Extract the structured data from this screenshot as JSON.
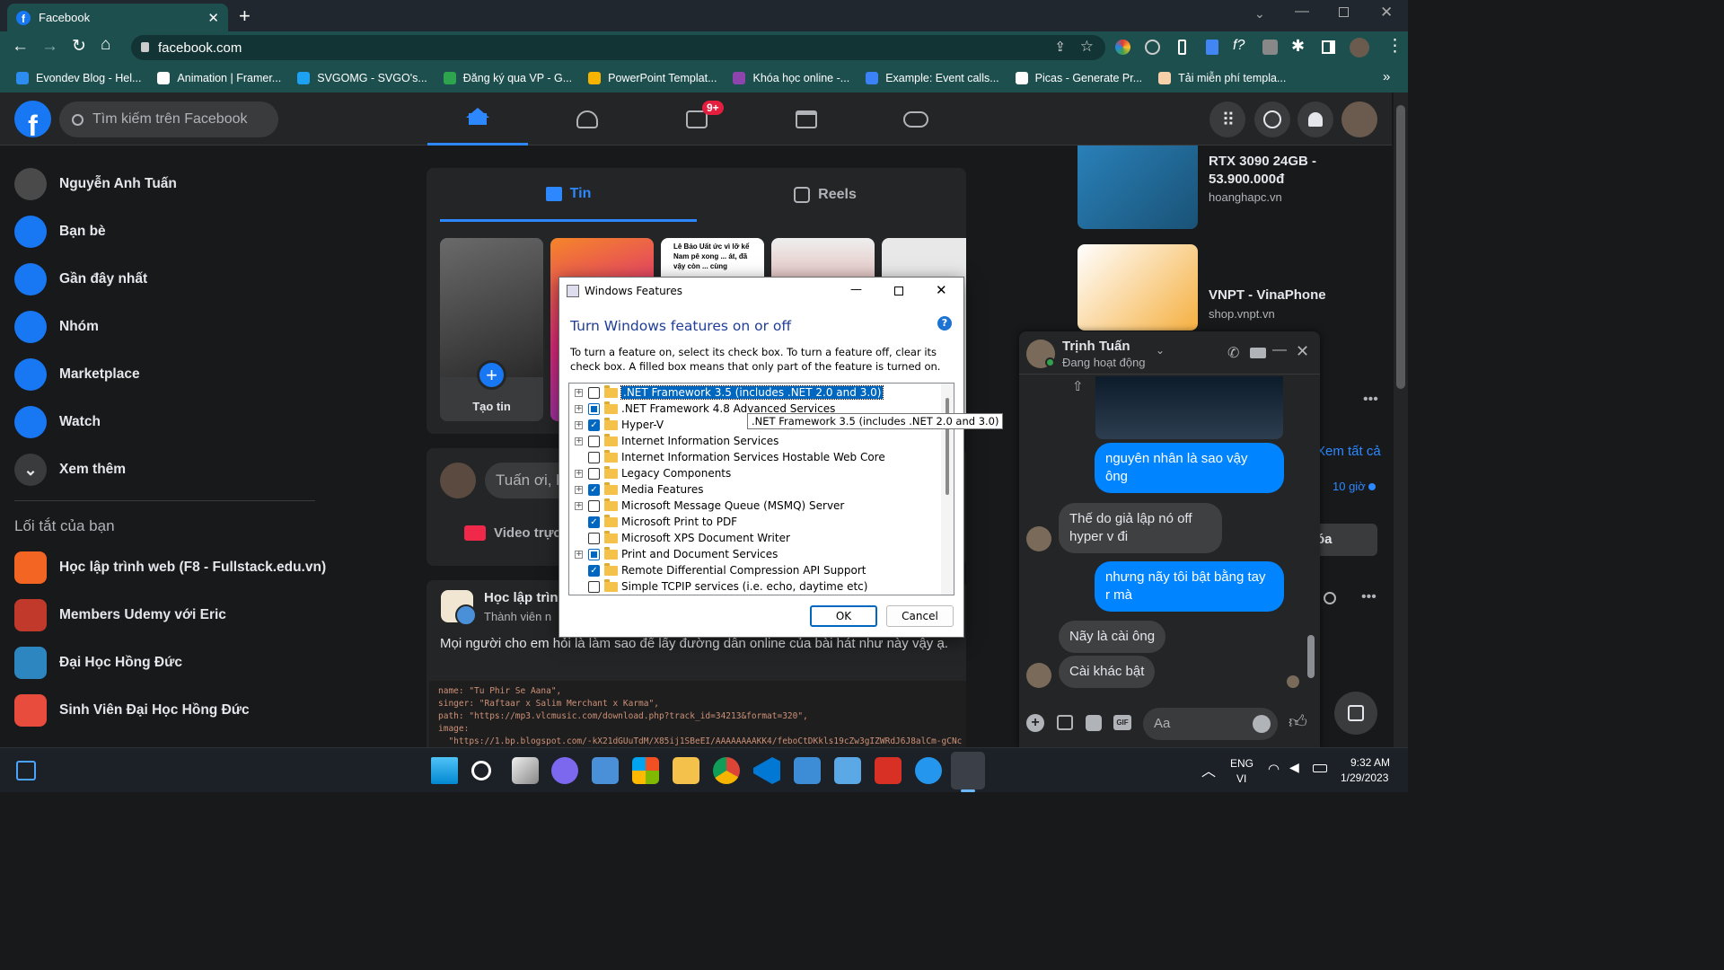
{
  "browser": {
    "tab_title": "Facebook",
    "url": "facebook.com",
    "bookmarks": [
      {
        "label": "Evondev Blog - Hel...",
        "color": "#2d8cf0"
      },
      {
        "label": "Animation | Framer...",
        "color": "#ffffff"
      },
      {
        "label": "SVGOMG - SVGO's...",
        "color": "#1da1f2"
      },
      {
        "label": "Đăng ký qua VP - G...",
        "color": "#2ea44f"
      },
      {
        "label": "PowerPoint Templat...",
        "color": "#f4b400"
      },
      {
        "label": "Khóa học online -...",
        "color": "#8e44ad"
      },
      {
        "label": "Example: Event calls...",
        "color": "#3b82f6"
      },
      {
        "label": "Picas - Generate Pr...",
        "color": "#ffffff"
      },
      {
        "label": "Tải miễn phí templa...",
        "color": "#f5d0a9"
      }
    ]
  },
  "fb": {
    "search_placeholder": "Tìm kiếm trên Facebook",
    "notification_badge": "9+",
    "sidebar": [
      {
        "label": "Nguyễn Anh Tuấn",
        "icon": "avatar",
        "color": "#4a4a4a"
      },
      {
        "label": "Bạn bè",
        "icon": "friends-icon",
        "color": "#1877f2"
      },
      {
        "label": "Gần đây nhất",
        "icon": "clock-icon",
        "color": "#1877f2"
      },
      {
        "label": "Nhóm",
        "icon": "groups-icon",
        "color": "#1877f2"
      },
      {
        "label": "Marketplace",
        "icon": "marketplace-icon",
        "color": "#1877f2"
      },
      {
        "label": "Watch",
        "icon": "watch-icon",
        "color": "#1877f2"
      },
      {
        "label": "Xem thêm",
        "icon": "chevron-down-icon",
        "color": "#3a3b3c"
      }
    ],
    "shortcuts_title": "Lối tắt của bạn",
    "shortcuts": [
      {
        "label": "Học lập trình web (F8 - Fullstack.edu.vn)",
        "color": "#f26522"
      },
      {
        "label": "Members Udemy với Eric",
        "color": "#c0392b"
      },
      {
        "label": "Đại Học Hồng Đức",
        "color": "#2e86c1"
      },
      {
        "label": "Sinh Viên Đại Học Hồng Đức",
        "color": "#e74c3c"
      }
    ],
    "feed": {
      "tab_stories": "Tin",
      "tab_reels": "Reels",
      "create_story": "Tạo tin",
      "story_thumb_text": "Lê Bảo Uất ức vì lỡ kể Nam pê xong ... át, đã vậy còn ... cùng",
      "composer_placeholder": "Tuấn ơi, b",
      "live_video": "Video trực",
      "post_group": "Học lập trìn",
      "post_member": "Thành viên n",
      "post_text": "Mọi người cho em hỏi là làm sao để lấy đường dẫn online của bài hát như này vậy ạ.",
      "code_lines": [
        "name: \"Tu Phir Se Aana\",",
        "singer: \"Raftaar x Salim Merchant x Karma\",",
        "path: \"https://mp3.vlcmusic.com/download.php?track_id=34213&format=320\",",
        "image:",
        "  \"https://1.bp.blogspot.com/-kX21dGUuTdM/X85ij1SBeEI/AAAAAAAAKK4/feboCtDKkls19cZw3gIZWRdJ6J8alCm-gCNc"
      ]
    },
    "ads": [
      {
        "title": "RTX 3090 24GB - 53.900.000đ",
        "domain": "hoanghapc.vn"
      },
      {
        "title": "VNPT - VinaPhone",
        "domain": "shop.vnpt.vn"
      }
    ],
    "right_partial": {
      "see_all": "Xem tất cả",
      "time": "10 giờ",
      "button": "óa"
    }
  },
  "dialog": {
    "title": "Windows Features",
    "heading": "Turn Windows features on or off",
    "description": "To turn a feature on, select its check box. To turn a feature off, clear its check box. A filled box means that only part of the feature is turned on.",
    "tooltip": ".NET Framework 3.5 (includes .NET 2.0 and 3.0)",
    "features": [
      {
        "label": ".NET Framework 3.5 (includes .NET 2.0 and 3.0)",
        "expand": true,
        "state": "unchecked",
        "selected": true
      },
      {
        "label": ".NET Framework 4.8 Advanced Services",
        "expand": true,
        "state": "partial",
        "selected": false
      },
      {
        "label": "Hyper-V",
        "expand": true,
        "state": "checked",
        "selected": false
      },
      {
        "label": "Internet Information Services",
        "expand": true,
        "state": "unchecked",
        "selected": false
      },
      {
        "label": "Internet Information Services Hostable Web Core",
        "expand": false,
        "state": "unchecked",
        "selected": false
      },
      {
        "label": "Legacy Components",
        "expand": true,
        "state": "unchecked",
        "selected": false
      },
      {
        "label": "Media Features",
        "expand": true,
        "state": "checked",
        "selected": false
      },
      {
        "label": "Microsoft Message Queue (MSMQ) Server",
        "expand": true,
        "state": "unchecked",
        "selected": false
      },
      {
        "label": "Microsoft Print to PDF",
        "expand": false,
        "state": "checked",
        "selected": false
      },
      {
        "label": "Microsoft XPS Document Writer",
        "expand": false,
        "state": "unchecked",
        "selected": false
      },
      {
        "label": "Print and Document Services",
        "expand": true,
        "state": "partial",
        "selected": false
      },
      {
        "label": "Remote Differential Compression API Support",
        "expand": false,
        "state": "checked",
        "selected": false
      },
      {
        "label": "Simple TCPIP services (i.e. echo, daytime etc)",
        "expand": false,
        "state": "unchecked",
        "selected": false
      }
    ],
    "ok": "OK",
    "cancel": "Cancel"
  },
  "chat": {
    "name": "Trịnh Tuấn",
    "status": "Đang hoạt động",
    "messages": [
      {
        "from": "me",
        "text": "nguyên nhân là sao vậy ông"
      },
      {
        "from": "them",
        "text": "Thế do giả lập nó off hyper v đi"
      },
      {
        "from": "me",
        "text": "nhưng nãy tôi bật bằng tay r mà"
      },
      {
        "from": "them",
        "text": "Nãy là cài ông"
      },
      {
        "from": "them",
        "text": "Cài khác bật"
      }
    ],
    "input_placeholder": "Aa"
  },
  "taskbar": {
    "lang_top": "ENG",
    "lang_bottom": "VI",
    "time": "9:32 AM",
    "date": "1/29/2023"
  }
}
